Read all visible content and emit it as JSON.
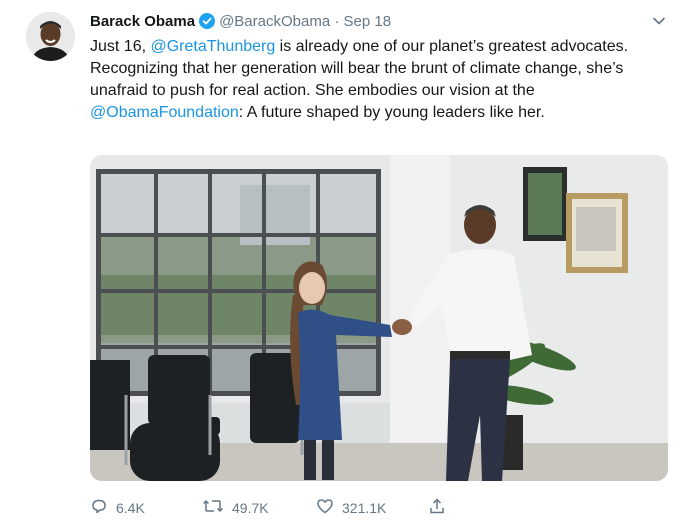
{
  "tweet": {
    "author_name": "Barack Obama",
    "handle": "@BarackObama",
    "separator": " · ",
    "date": "Sep 18",
    "text_1": "Just 16, ",
    "mention_1": "@GretaThunberg",
    "text_2": " is already one of our planet’s greatest advocates. Recognizing that her generation will bear the brunt of climate change, she’s unafraid to push for real action. She embodies our vision at the ",
    "mention_2": "@ObamaFoundation",
    "text_3": ": A future shaped by young leaders like her."
  },
  "actions": {
    "replies": "6.4K",
    "retweets": "49.7K",
    "likes": "321.1K"
  },
  "icons": {
    "verified": "verified-badge-icon",
    "menu": "chevron-down-icon",
    "reply": "reply-icon",
    "retweet": "retweet-icon",
    "like": "heart-icon",
    "share": "share-icon"
  },
  "colors": {
    "link": "#1b95e0",
    "muted": "#657786",
    "verified": "#1da1f2"
  }
}
